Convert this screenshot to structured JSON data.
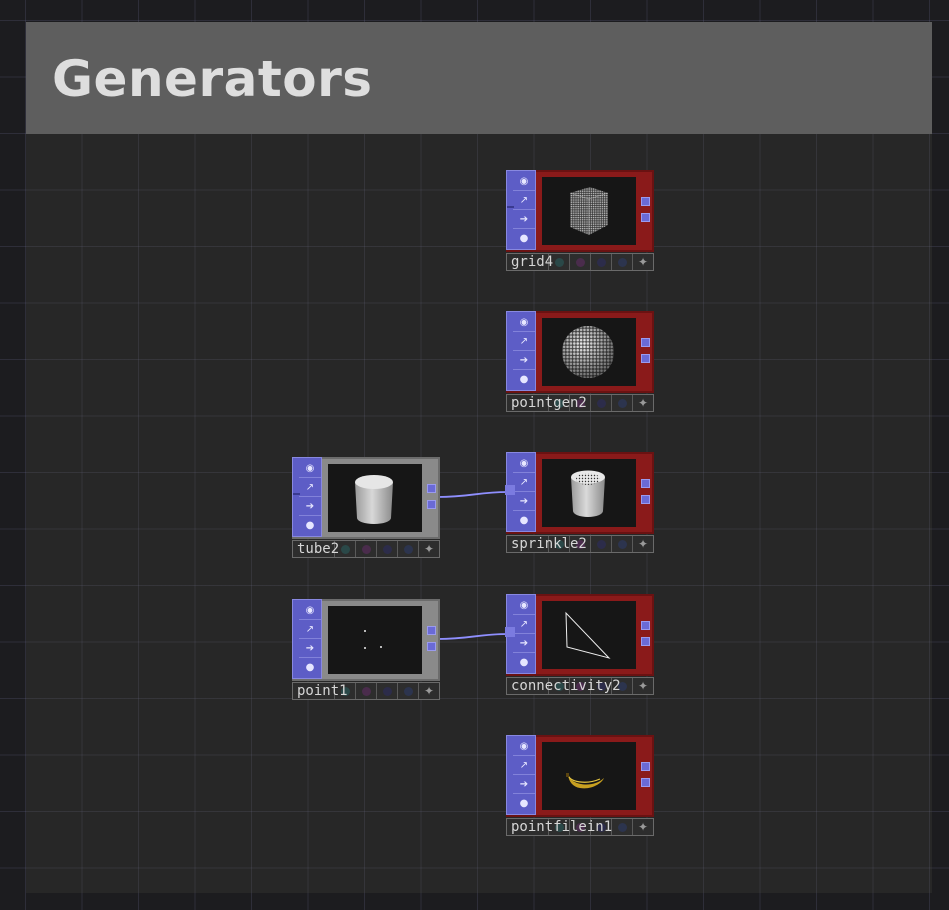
{
  "annotation": {
    "title": "Generators"
  },
  "nodes": [
    {
      "id": "grid4",
      "label": "grid4",
      "preview": "point-cube"
    },
    {
      "id": "pointgen2",
      "label": "pointgen2",
      "preview": "point-sphere"
    },
    {
      "id": "tube2",
      "label": "tube2",
      "preview": "cylinder"
    },
    {
      "id": "sprinkle2",
      "label": "sprinkle2",
      "preview": "sprinkled-cylinder"
    },
    {
      "id": "point1",
      "label": "point1",
      "preview": "three-points"
    },
    {
      "id": "connectivity2",
      "label": "connectivity2",
      "preview": "triangle-outline"
    },
    {
      "id": "pointfilein1",
      "label": "pointfilein1",
      "preview": "banana"
    }
  ],
  "strip_icons": [
    "info-icon",
    "chart-icon",
    "arrow-right-icon",
    "bomb-icon"
  ],
  "flag_icons": [
    "display-flag",
    "render-flag",
    "bypass-flag",
    "lock-flag",
    "viewer-star-icon"
  ],
  "wires": [
    {
      "from": "tube2",
      "to": "sprinkle2"
    },
    {
      "from": "point1",
      "to": "connectivity2"
    }
  ],
  "colors": {
    "sop_node": "#8a1a1a",
    "generator_node": "#8a8a8a",
    "strip": "#5d5dc6",
    "wire": "#8f8fff",
    "annotation_header": "#5e5e5e"
  }
}
